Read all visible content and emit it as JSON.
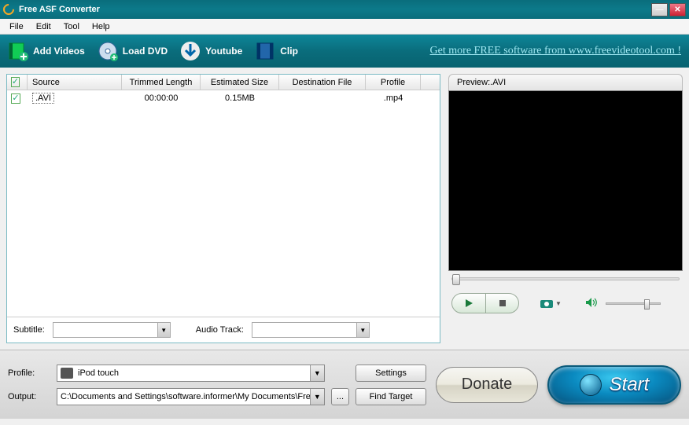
{
  "window": {
    "title": "Free ASF Converter"
  },
  "menus": [
    "File",
    "Edit",
    "Tool",
    "Help"
  ],
  "toolbar": {
    "add_videos": "Add Videos",
    "load_dvd": "Load DVD",
    "youtube": "Youtube",
    "clip": "Clip",
    "promo_link": "Get more FREE software from www.freevideotool.com !"
  },
  "grid": {
    "headers": {
      "source": "Source",
      "trimmed": "Trimmed Length",
      "size": "Estimated Size",
      "dest": "Destination File",
      "profile": "Profile"
    },
    "rows": [
      {
        "checked": true,
        "source": ".AVI",
        "trimmed": "00:00:00",
        "size": "0.15MB",
        "dest": "",
        "profile": ".mp4"
      }
    ]
  },
  "subtitle_label": "Subtitle:",
  "audio_track_label": "Audio Track:",
  "subtitle_value": "",
  "audio_track_value": "",
  "preview": {
    "label": "Preview:.AVI"
  },
  "bottom": {
    "profile_label": "Profile:",
    "profile_value": "iPod touch",
    "settings_btn": "Settings",
    "output_label": "Output:",
    "output_value": "C:\\Documents and Settings\\software.informer\\My Documents\\Fre",
    "browse_btn": "...",
    "find_target_btn": "Find Target",
    "donate": "Donate",
    "start": "Start"
  }
}
